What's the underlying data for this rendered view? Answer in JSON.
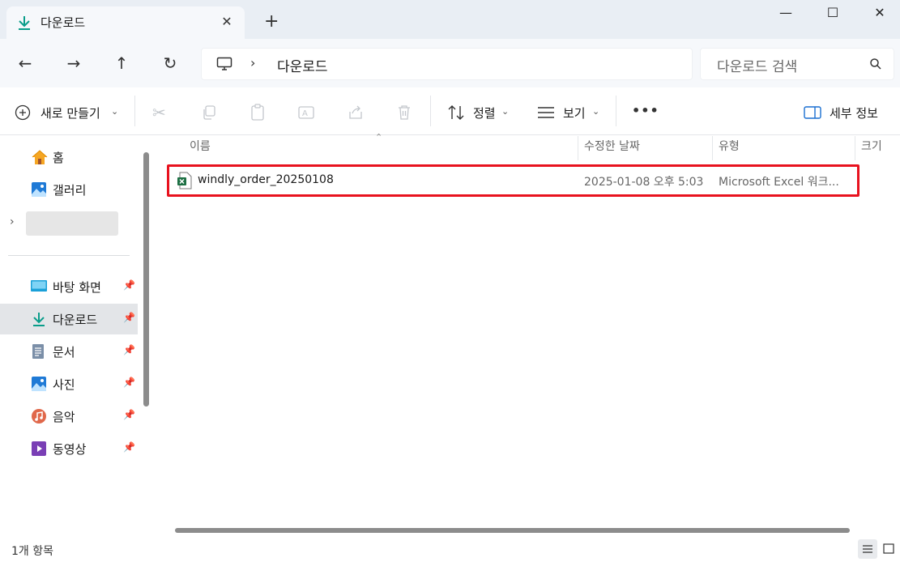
{
  "window": {
    "tab_title": "다운로드",
    "close_tab": "✕",
    "new_tab": "+",
    "min": "—",
    "max": "☐",
    "close": "✕"
  },
  "nav": {
    "back": "←",
    "forward": "→",
    "up": "↑",
    "refresh": "↻",
    "breadcrumb_chevron": "›",
    "breadcrumb": "다운로드",
    "search_placeholder": "다운로드 검색"
  },
  "toolbar": {
    "new_label": "새로 만들기",
    "sort_label": "정렬",
    "view_label": "보기",
    "more": "•••",
    "details_label": "세부 정보"
  },
  "sidebar": {
    "top_items": [
      {
        "label": "홈"
      },
      {
        "label": "갤러리"
      }
    ],
    "quick_access": [
      {
        "label": "바탕 화면"
      },
      {
        "label": "다운로드"
      },
      {
        "label": "문서"
      },
      {
        "label": "사진"
      },
      {
        "label": "음악"
      },
      {
        "label": "동영상"
      }
    ]
  },
  "columns": {
    "name": "이름",
    "modified": "수정한 날짜",
    "type": "유형",
    "size": "크기"
  },
  "files": [
    {
      "name": "windly_order_20250108",
      "modified": "2025-01-08 오후 5:03",
      "type": "Microsoft Excel 워크..."
    }
  ],
  "status": {
    "count": "1개 항목"
  },
  "colors": {
    "accent": "#0a9d8a",
    "highlight": "#e8121e",
    "excel": "#1d7044"
  }
}
